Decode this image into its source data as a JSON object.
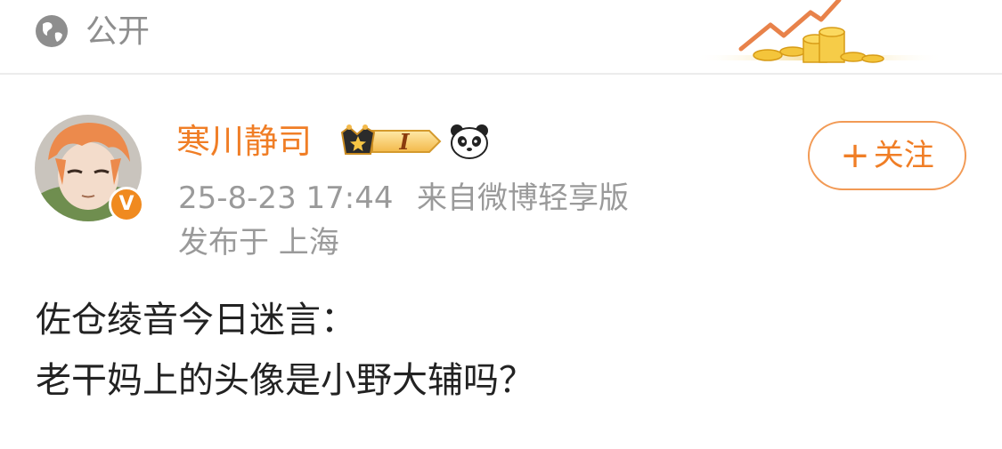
{
  "header": {
    "visibility_icon": "globe-icon",
    "visibility_label": "公开",
    "banner_icon": "rising-chart-coins-icon"
  },
  "post": {
    "author": {
      "name": "寒川静司",
      "verified_badge": "V",
      "level_badge": "I",
      "badge_icons": [
        "crown-level-icon",
        "panda-icon"
      ]
    },
    "timestamp": "25-8-23 17:44",
    "source": "来自微博轻享版",
    "location": "发布于 上海",
    "follow_label": "关注",
    "follow_icon": "plus-icon",
    "content_lines": [
      "佐仓绫音今日迷言：",
      "老干妈上的头像是小野大辅吗？"
    ]
  },
  "colors": {
    "accent": "#f07e26",
    "meta_text": "#9a9a9a",
    "body_text": "#222222"
  }
}
